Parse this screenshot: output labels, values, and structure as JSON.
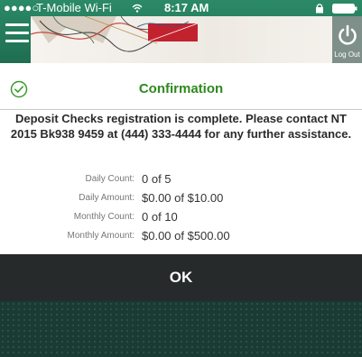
{
  "status_bar": {
    "signal": "●●●●○",
    "carrier": "T-Mobile Wi-Fi",
    "time": "8:17 AM"
  },
  "header": {
    "logout_label": "Log Out"
  },
  "dialog": {
    "title": "Confirmation",
    "message": "Deposit Checks registration is complete. Please contact NT 2015 Bk938 9459 at (444) 333-4444 for any further assistance.",
    "title_color": "#2e8a1f",
    "stats": [
      {
        "label": "Daily Count:",
        "value": "0 of 5"
      },
      {
        "label": "Daily Amount:",
        "value": "$0.00 of $10.00"
      },
      {
        "label": "Monthly Count:",
        "value": "0 of 10"
      },
      {
        "label": "Monthly Amount:",
        "value": "$0.00 of $500.00"
      }
    ]
  },
  "ok_button": {
    "label": "OK"
  },
  "icons": [
    "wifi-icon",
    "lock-icon",
    "battery-icon",
    "menu-icon",
    "power-icon",
    "check-circle-icon"
  ]
}
